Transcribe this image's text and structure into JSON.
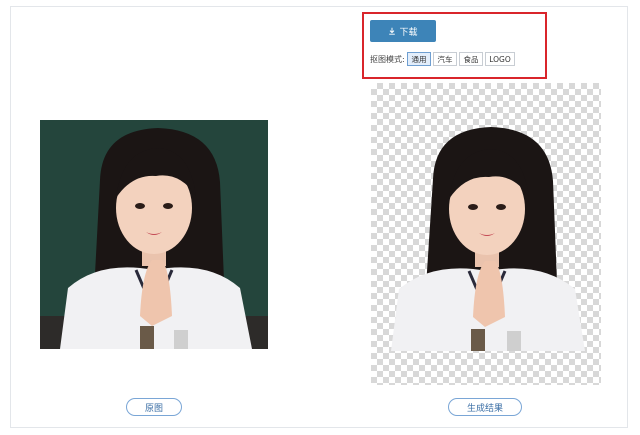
{
  "toolbar": {
    "download_label": "下载",
    "download_icon": "download-icon",
    "mode_label": "抠图模式:",
    "modes": [
      "通用",
      "汽车",
      "食品",
      "LOGO"
    ],
    "active_mode": "通用"
  },
  "captions": {
    "original": "原图",
    "result": "生成结果"
  },
  "colors": {
    "accent": "#3d84b8",
    "highlight": "#d9252b",
    "chalkboard": "#24453c",
    "pill_border": "#7aa6d6"
  }
}
